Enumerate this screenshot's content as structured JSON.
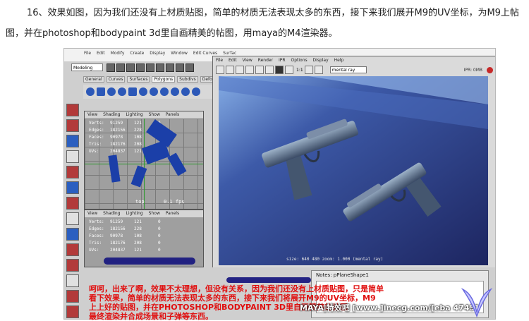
{
  "article": {
    "paragraph": "16、效果如图，因为我们还没有上材质贴图，简单的材质无法表现太多的东西，接下来我们展开M9的UV坐标，为M9上帖图，并在photoshop和bodypaint 3d里自画精美的帖图，用maya的M4渲染器。"
  },
  "maya": {
    "main_menu": [
      "File",
      "Edit",
      "Modify",
      "Create",
      "Display",
      "Window",
      "Edit Curves",
      "Surfac"
    ],
    "mode": "Modeling",
    "shelf_tabs": [
      "General",
      "Curves",
      "Surfaces",
      "Polygons",
      "Subdivs",
      "Deformatio"
    ],
    "active_shelf_tab": "Polygons",
    "viewport_menu": [
      "View",
      "Shading",
      "Lighting",
      "Show",
      "Panels"
    ],
    "stats_top": [
      {
        "label": "Verts:",
        "v1": "91259",
        "v2": "121",
        "v3": "0"
      },
      {
        "label": "Edges:",
        "v1": "182156",
        "v2": "228",
        "v3": "0"
      },
      {
        "label": "Faces:",
        "v1": "90978",
        "v2": "108",
        "v3": "0"
      },
      {
        "label": "Tris:",
        "v1": "182176",
        "v2": "208",
        "v3": "0"
      },
      {
        "label": "UVs:",
        "v1": "204837",
        "v2": "121",
        "v3": "0"
      }
    ],
    "stats_bottom": [
      {
        "label": "Verts:",
        "v1": "91259",
        "v2": "121",
        "v3": "0"
      },
      {
        "label": "Edges:",
        "v1": "182156",
        "v2": "228",
        "v3": "0"
      },
      {
        "label": "Faces:",
        "v1": "90978",
        "v2": "108",
        "v3": "0"
      },
      {
        "label": "Tris:",
        "v1": "182176",
        "v2": "208",
        "v3": "0"
      },
      {
        "label": "UVs:",
        "v1": "204837",
        "v2": "121",
        "v3": "0"
      }
    ],
    "viewport_label": "top",
    "fps": "0.1 fps"
  },
  "render_view": {
    "menu": [
      "File",
      "Edit",
      "View",
      "Render",
      "IPR",
      "Options",
      "Display",
      "Help"
    ],
    "ratio": "1:1",
    "renderer": "mental ray",
    "ipr_label": "IPR: 0MB",
    "info": "size:  640  480  zoom: 1.000   (mental ray)"
  },
  "notes": {
    "label": "Notes:  pPlaneShape1"
  },
  "overlay_text": [
    "呵呵，出来了啊，效果不太理想，但没有关系，因为我们还没有上材质贴图，只是简单",
    "看下效果，简单的材质无法表现太多的东西，接下来我们将展开M9的UV坐标，M9",
    "上上好的贴图，并在PHOTOSHOP和BODYPAINT 3D里自画精美的帖图",
    "最终渲染并合成场景和子弹等东西。"
  ],
  "watermark": "MAYA|特效吧  [www.]inecg.com/[eba 4745]",
  "colors": {
    "uv_blue": "#1b3fa8",
    "render_bg": "#2d3a7c",
    "overlay_red": "#e01010"
  }
}
